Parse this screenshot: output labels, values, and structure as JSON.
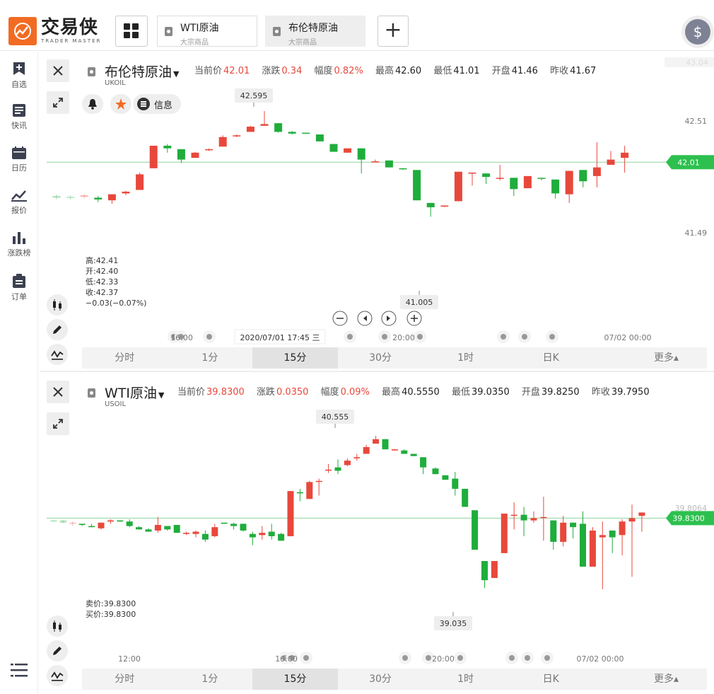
{
  "app": {
    "name_cn": "交易侠",
    "name_en": "TRADER MASTER",
    "brand_color": "#f26b22"
  },
  "tabs": [
    {
      "title": "WTI原油",
      "subtitle": "大宗商品",
      "active": false
    },
    {
      "title": "布伦特原油",
      "subtitle": "大宗商品",
      "active": true
    }
  ],
  "currency_icon": "$",
  "sidebar": {
    "items": [
      {
        "label": "自选",
        "icon": "bookmark-plus-icon"
      },
      {
        "label": "快讯",
        "icon": "news-icon"
      },
      {
        "label": "日历",
        "icon": "calendar-icon"
      },
      {
        "label": "报价",
        "icon": "line-chart-icon"
      },
      {
        "label": "涨跌榜",
        "icon": "bar-chart-icon"
      },
      {
        "label": "订单",
        "icon": "clipboard-icon"
      }
    ]
  },
  "colors": {
    "up": "#e8483c",
    "down": "#1fad3c",
    "priceTag": "#2dc04e"
  },
  "panel1": {
    "name": "布伦特原油",
    "code": "UKOIL",
    "quote": {
      "current_label": "当前价",
      "current": "42.01",
      "change_label": "涨跌",
      "change": "0.34",
      "pct_label": "幅度",
      "pct": "0.82%",
      "high_label": "最高",
      "high": "42.60",
      "low_label": "最低",
      "low": "41.01",
      "open_label": "开盘",
      "open": "41.46",
      "prev_label": "昨收",
      "prev": "41.67"
    },
    "info_label": "信息",
    "ohlc": [
      "高:42.41",
      "开:42.40",
      "低:42.33",
      "收:42.37",
      "−0.03(−0.07%)"
    ],
    "price_tag": "42.01",
    "y_ticks": [
      "42.51",
      "41.49"
    ],
    "top_faint": "43.04",
    "peak_label": "42.595",
    "trough_label": "41.005",
    "crosshair_time": "2020/07/01 17:45 三",
    "x_labels": [
      "16:00",
      "20:00",
      "07/02 00:00"
    ],
    "timeframes": [
      "分时",
      "1分",
      "15分",
      "30分",
      "1时",
      "日K",
      "更多▴"
    ],
    "active_tf": 2
  },
  "panel2": {
    "name": "WTI原油",
    "code": "USOIL",
    "quote": {
      "current_label": "当前价",
      "current": "39.8300",
      "change_label": "涨跌",
      "change": "0.0350",
      "pct_label": "幅度",
      "pct": "0.09%",
      "high_label": "最高",
      "high": "40.5550",
      "low_label": "最低",
      "low": "39.0350",
      "open_label": "开盘",
      "open": "39.8250",
      "prev_label": "昨收",
      "prev": "39.7950"
    },
    "ohlc": [
      "卖价:39.8300",
      "买价:39.8300"
    ],
    "price_tag": "39.8300",
    "y_faint": "39.8064",
    "peak_label": "40.555",
    "trough_label": "39.035",
    "x_labels": [
      "12:00",
      "16:00",
      "20:00",
      "07/02 00:00"
    ],
    "timeframes": [
      "分时",
      "1分",
      "15分",
      "30分",
      "1时",
      "日K",
      "更多▴"
    ],
    "active_tf": 2
  },
  "chart_data": [
    {
      "type": "candlestick",
      "title": "布伦特原油 UKOIL 15分",
      "ylim": [
        41.0,
        42.6
      ],
      "last_price": 42.01,
      "candles": [
        [
          41.62,
          41.64,
          41.58,
          41.6
        ],
        [
          41.61,
          41.63,
          41.58,
          41.6
        ],
        [
          41.61,
          41.64,
          41.59,
          41.63
        ],
        [
          41.6,
          41.62,
          41.55,
          41.58
        ],
        [
          41.57,
          41.64,
          41.53,
          41.64
        ],
        [
          41.65,
          41.68,
          41.63,
          41.67
        ],
        [
          41.69,
          41.89,
          41.69,
          41.87
        ],
        [
          41.94,
          42.2,
          41.94,
          42.2
        ],
        [
          42.2,
          42.22,
          42.12,
          42.17
        ],
        [
          42.16,
          42.16,
          42.0,
          42.04
        ],
        [
          42.06,
          42.13,
          42.06,
          42.12
        ],
        [
          42.15,
          42.17,
          42.14,
          42.16
        ],
        [
          42.19,
          42.32,
          42.19,
          42.3
        ],
        [
          42.31,
          42.33,
          42.3,
          42.32
        ],
        [
          42.36,
          42.43,
          42.36,
          42.42
        ],
        [
          42.43,
          42.6,
          42.43,
          42.45
        ],
        [
          42.46,
          42.46,
          42.35,
          42.36
        ],
        [
          42.36,
          42.37,
          42.33,
          42.34
        ],
        [
          42.35,
          42.35,
          42.34,
          42.34
        ],
        [
          42.33,
          42.33,
          42.25,
          42.25
        ],
        [
          42.22,
          42.22,
          42.13,
          42.13
        ],
        [
          42.12,
          42.17,
          42.12,
          42.17
        ],
        [
          42.17,
          42.17,
          41.88,
          42.04
        ],
        [
          42.02,
          42.04,
          42.01,
          42.02
        ],
        [
          42.03,
          42.03,
          41.95,
          41.95
        ],
        [
          41.94,
          41.94,
          41.92,
          41.93
        ],
        [
          41.92,
          41.92,
          41.57,
          41.57
        ],
        [
          41.54,
          41.54,
          41.38,
          41.49
        ],
        [
          41.51,
          41.51,
          41.49,
          41.51
        ],
        [
          41.56,
          41.9,
          41.56,
          41.9
        ],
        [
          41.89,
          41.89,
          41.74,
          41.89
        ],
        [
          41.88,
          41.88,
          41.76,
          41.84
        ],
        [
          41.82,
          41.98,
          41.8,
          41.83
        ],
        [
          41.83,
          41.83,
          41.62,
          41.7
        ],
        [
          41.71,
          41.85,
          41.71,
          41.85
        ],
        [
          41.83,
          41.83,
          41.8,
          41.82
        ],
        [
          41.81,
          41.81,
          41.59,
          41.65
        ],
        [
          41.64,
          41.91,
          41.54,
          41.91
        ],
        [
          41.92,
          41.92,
          41.72,
          41.79
        ],
        [
          41.85,
          42.24,
          41.72,
          41.95
        ],
        [
          41.98,
          42.14,
          41.99,
          42.04
        ],
        [
          42.06,
          42.2,
          41.89,
          42.12
        ]
      ]
    },
    {
      "type": "candlestick",
      "title": "WTI原油 USOIL 15分",
      "ylim": [
        39.03,
        40.56
      ],
      "last_price": 39.83,
      "candles": [
        [
          39.81,
          39.81,
          39.8,
          39.8
        ],
        [
          39.81,
          39.81,
          39.79,
          39.79
        ],
        [
          39.78,
          39.8,
          39.76,
          39.79
        ],
        [
          39.78,
          39.78,
          39.76,
          39.77
        ],
        [
          39.76,
          39.78,
          39.75,
          39.75
        ],
        [
          39.74,
          39.79,
          39.73,
          39.79
        ],
        [
          39.8,
          39.82,
          39.78,
          39.81
        ],
        [
          39.81,
          39.81,
          39.8,
          39.8
        ],
        [
          39.8,
          39.82,
          39.75,
          39.76
        ],
        [
          39.75,
          39.76,
          39.73,
          39.73
        ],
        [
          39.73,
          39.74,
          39.71,
          39.71
        ],
        [
          39.72,
          39.84,
          39.7,
          39.77
        ],
        [
          39.76,
          39.76,
          39.72,
          39.73
        ],
        [
          39.77,
          39.77,
          39.7,
          39.7
        ],
        [
          39.69,
          39.71,
          39.68,
          39.7
        ],
        [
          39.69,
          39.72,
          39.66,
          39.71
        ],
        [
          39.69,
          39.72,
          39.62,
          39.64
        ],
        [
          39.67,
          39.78,
          39.66,
          39.75
        ],
        [
          39.79,
          39.79,
          39.78,
          39.78
        ],
        [
          39.78,
          39.79,
          39.73,
          39.76
        ],
        [
          39.78,
          39.78,
          39.71,
          39.72
        ],
        [
          39.69,
          39.71,
          39.59,
          39.66
        ],
        [
          39.68,
          39.76,
          39.64,
          39.7
        ],
        [
          39.71,
          39.78,
          39.64,
          39.67
        ],
        [
          39.69,
          39.7,
          39.63,
          39.63
        ],
        [
          39.67,
          40.07,
          39.67,
          40.07
        ],
        [
          40.06,
          40.09,
          39.98,
          40.05
        ],
        [
          40.0,
          40.16,
          40.02,
          40.15
        ],
        [
          40.16,
          40.18,
          40.03,
          40.16
        ],
        [
          40.26,
          40.31,
          40.23,
          40.26
        ],
        [
          40.28,
          40.35,
          40.22,
          40.25
        ],
        [
          40.3,
          40.36,
          40.29,
          40.34
        ],
        [
          40.36,
          40.4,
          40.34,
          40.37
        ],
        [
          40.4,
          40.48,
          40.4,
          40.46
        ],
        [
          40.49,
          40.56,
          40.49,
          40.53
        ],
        [
          40.53,
          40.53,
          40.44,
          40.44
        ],
        [
          40.43,
          40.44,
          40.43,
          40.44
        ],
        [
          40.43,
          40.44,
          40.4,
          40.4
        ],
        [
          40.4,
          40.4,
          40.38,
          40.38
        ],
        [
          40.37,
          40.37,
          40.22,
          40.28
        ]
      ]
    }
  ]
}
